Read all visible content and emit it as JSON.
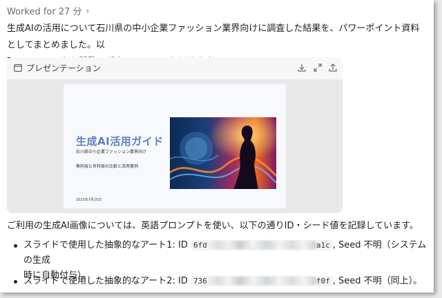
{
  "status": {
    "worked_label": "Worked for 27 分"
  },
  "message": {
    "line1": "生成AIの活用について石川県の中小企業ファッション業界向けに調査した結果を、パワーポイント資料としてまとめました。以",
    "line2": "下のファイルから閲覧・ダウンロードいただけます。"
  },
  "attachment": {
    "title": "プレゼンテーション",
    "actions": [
      "download-icon",
      "expand-icon",
      "share-icon"
    ],
    "slide": {
      "title": "生成AI活用ガイド",
      "subtitle": "石川県中小企業ファッション業界向け",
      "subtitle2": "無料版と有料版の比較と活用事例",
      "date": "2025年7月25日"
    }
  },
  "notes": {
    "intro": "ご利用の生成AI画像については、英語プロンプトを使い、以下の通りID・シード値を記録しています。",
    "items": [
      {
        "prefix": "スライドで使用した抽象的なアート1: ID",
        "id_start": "6fd",
        "id_end": "a1c",
        "suffix": ", Seed 不明（システムの生成",
        "suffix2": "時に自動付与）。"
      },
      {
        "prefix": "スライドで使用した抽象的なアート2: ID",
        "id_start": "736",
        "id_end": "f0f",
        "suffix": ", Seed 不明（同上）。",
        "suffix2": ""
      }
    ]
  },
  "colors": {
    "slide_title": "#5d7fc4",
    "card_bg": "#f3f3f3"
  }
}
